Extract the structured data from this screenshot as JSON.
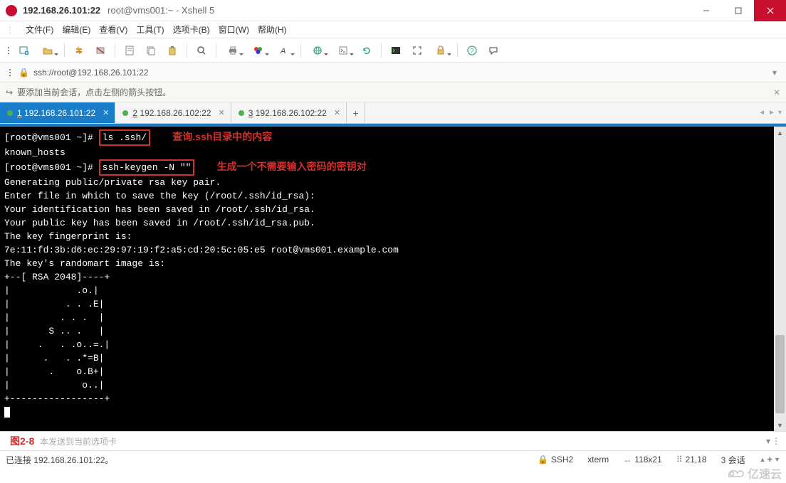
{
  "window": {
    "title_main": "192.168.26.101:22",
    "title_sub": "root@vms001:~ - Xshell 5"
  },
  "menu": {
    "items": [
      "文件(F)",
      "编辑(E)",
      "查看(V)",
      "工具(T)",
      "选项卡(B)",
      "窗口(W)",
      "帮助(H)"
    ]
  },
  "address": {
    "url": "ssh://root@192.168.26.101:22"
  },
  "infobar": {
    "text": "要添加当前会话，点击左侧的箭头按钮。"
  },
  "tabs": {
    "items": [
      {
        "num": "1",
        "label": "192.168.26.101:22",
        "active": true
      },
      {
        "num": "2",
        "label": "192.168.26.102:22",
        "active": false
      },
      {
        "num": "3",
        "label": "192.168.26.102:22",
        "active": false
      }
    ]
  },
  "terminal": {
    "prompt1": "[root@vms001 ~]#",
    "cmd1": "ls .ssh/",
    "anno1": "查询.ssh目录中的内容",
    "line2": "known_hosts",
    "prompt2": "[root@vms001 ~]#",
    "cmd2": "ssh-keygen -N \"\"",
    "anno2": "生成一个不需要输入密码的密钥对",
    "line4": "Generating public/private rsa key pair.",
    "line5": "Enter file in which to save the key (/root/.ssh/id_rsa):",
    "line6": "Your identification has been saved in /root/.ssh/id_rsa.",
    "line7": "Your public key has been saved in /root/.ssh/id_rsa.pub.",
    "line8": "The key fingerprint is:",
    "line9": "7e:11:fd:3b:d6:ec:29:97:19:f2:a5:cd:20:5c:05:e5 root@vms001.example.com",
    "line10": "The key's randomart image is:",
    "art": "+--[ RSA 2048]----+\n|            .o.|\n|          . . .E|\n|         . . .  |\n|       S .. .   |\n|     .   . .o..=.|\n|      .   . .*=B|\n|       .    o.B+|\n|             o..|\n+-----------------+"
  },
  "bottom": {
    "figure": "图2-8",
    "placeholder": "本发送到当前选项卡"
  },
  "status": {
    "connected": "已连接 192.168.26.101:22。",
    "proto": "SSH2",
    "term": "xterm",
    "size": "118x21",
    "cursor": "21,18",
    "sessions": "3 会话"
  },
  "watermark": "亿速云"
}
